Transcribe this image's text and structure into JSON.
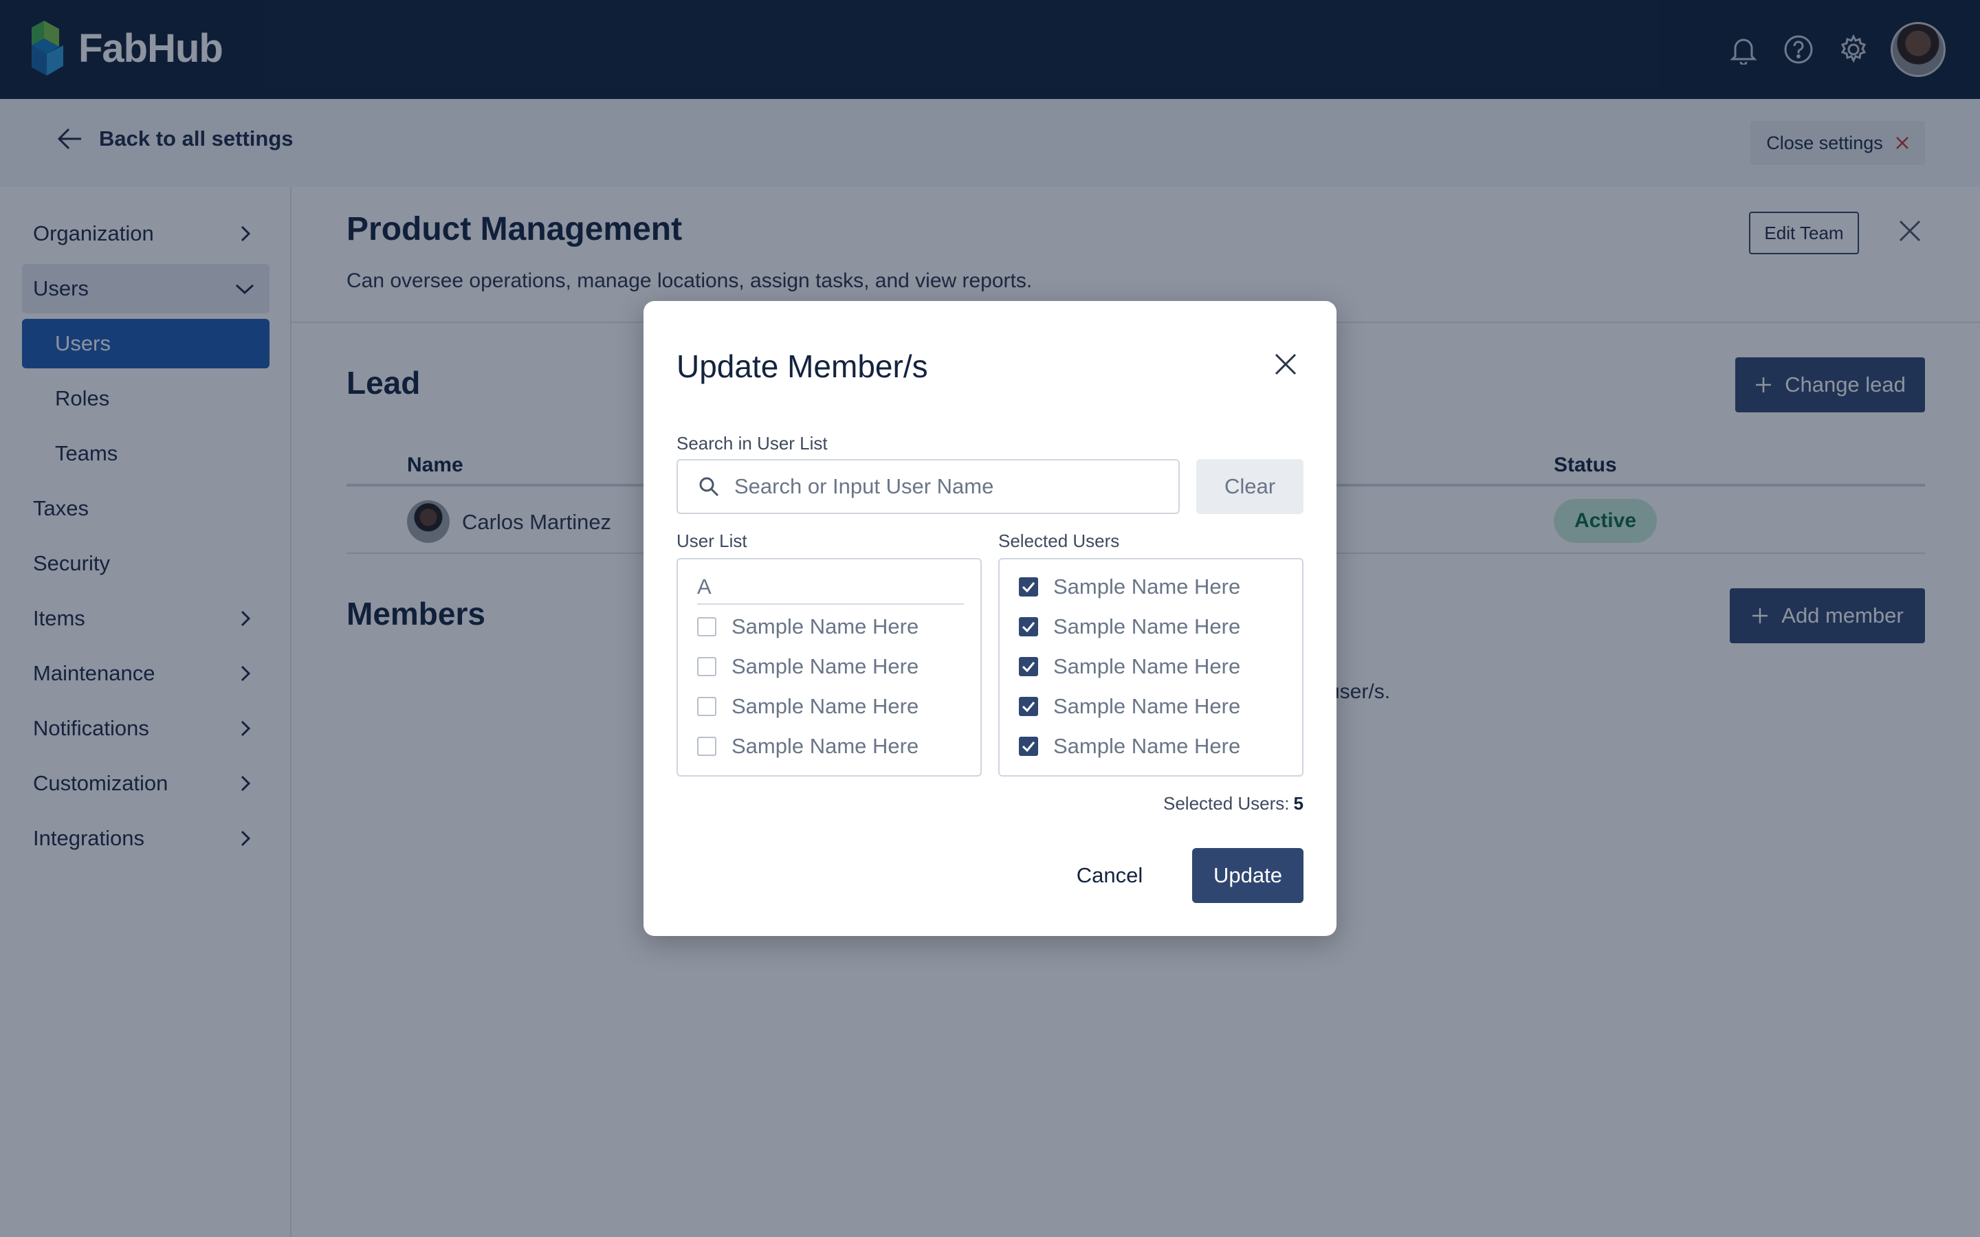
{
  "app": {
    "name": "FabHub"
  },
  "topbar": {
    "icons": [
      "bell-icon",
      "help-icon",
      "gear-icon"
    ],
    "avatar_alt": "user-avatar"
  },
  "settings_bar": {
    "back_label": "Back to all settings",
    "close_label": "Close settings"
  },
  "sidebar": {
    "items": [
      {
        "label": "Organization",
        "chevron": "right"
      },
      {
        "label": "Users",
        "chevron": "down",
        "expanded": true
      },
      {
        "label": "Users",
        "sub": true,
        "active": true
      },
      {
        "label": "Roles",
        "sub": true
      },
      {
        "label": "Teams",
        "sub": true
      },
      {
        "label": "Taxes"
      },
      {
        "label": "Security"
      },
      {
        "label": "Items",
        "chevron": "right"
      },
      {
        "label": "Maintenance",
        "chevron": "right"
      },
      {
        "label": "Notifications",
        "chevron": "right"
      },
      {
        "label": "Customization",
        "chevron": "right"
      },
      {
        "label": "Integrations",
        "chevron": "right"
      }
    ]
  },
  "team": {
    "title": "Product Management",
    "description": "Can oversee operations, manage locations, assign tasks, and view reports.",
    "edit_label": "Edit Team"
  },
  "lead": {
    "section_title": "Lead",
    "change_label": "Change lead",
    "columns": {
      "name": "Name",
      "status": "Status"
    },
    "row": {
      "name": "Carlos Martinez",
      "status": "Active"
    }
  },
  "members": {
    "section_title": "Members",
    "add_label": "Add member",
    "hint_visible": "user/s."
  },
  "modal": {
    "title": "Update Member/s",
    "search_label": "Search in User List",
    "search_placeholder": "Search or Input User Name",
    "search_value": "",
    "clear_label": "Clear",
    "user_list_label": "User List",
    "group_letter": "A",
    "user_list": [
      {
        "name": "Sample Name Here",
        "checked": false
      },
      {
        "name": "Sample Name Here",
        "checked": false
      },
      {
        "name": "Sample Name Here",
        "checked": false
      },
      {
        "name": "Sample Name Here",
        "checked": false
      }
    ],
    "selected_label": "Selected Users",
    "selected_list": [
      {
        "name": "Sample Name Here",
        "checked": true
      },
      {
        "name": "Sample Name Here",
        "checked": true
      },
      {
        "name": "Sample Name Here",
        "checked": true
      },
      {
        "name": "Sample Name Here",
        "checked": true
      },
      {
        "name": "Sample Name Here",
        "checked": true
      }
    ],
    "selected_count_label": "Selected Users:",
    "selected_count": "5",
    "cancel_label": "Cancel",
    "update_label": "Update"
  },
  "colors": {
    "topbar": "#0f1f38",
    "primary": "#2f4770",
    "active_nav": "#1d5ab0",
    "status_active_bg": "#c8eedb",
    "status_active_text": "#0c6b3e"
  }
}
